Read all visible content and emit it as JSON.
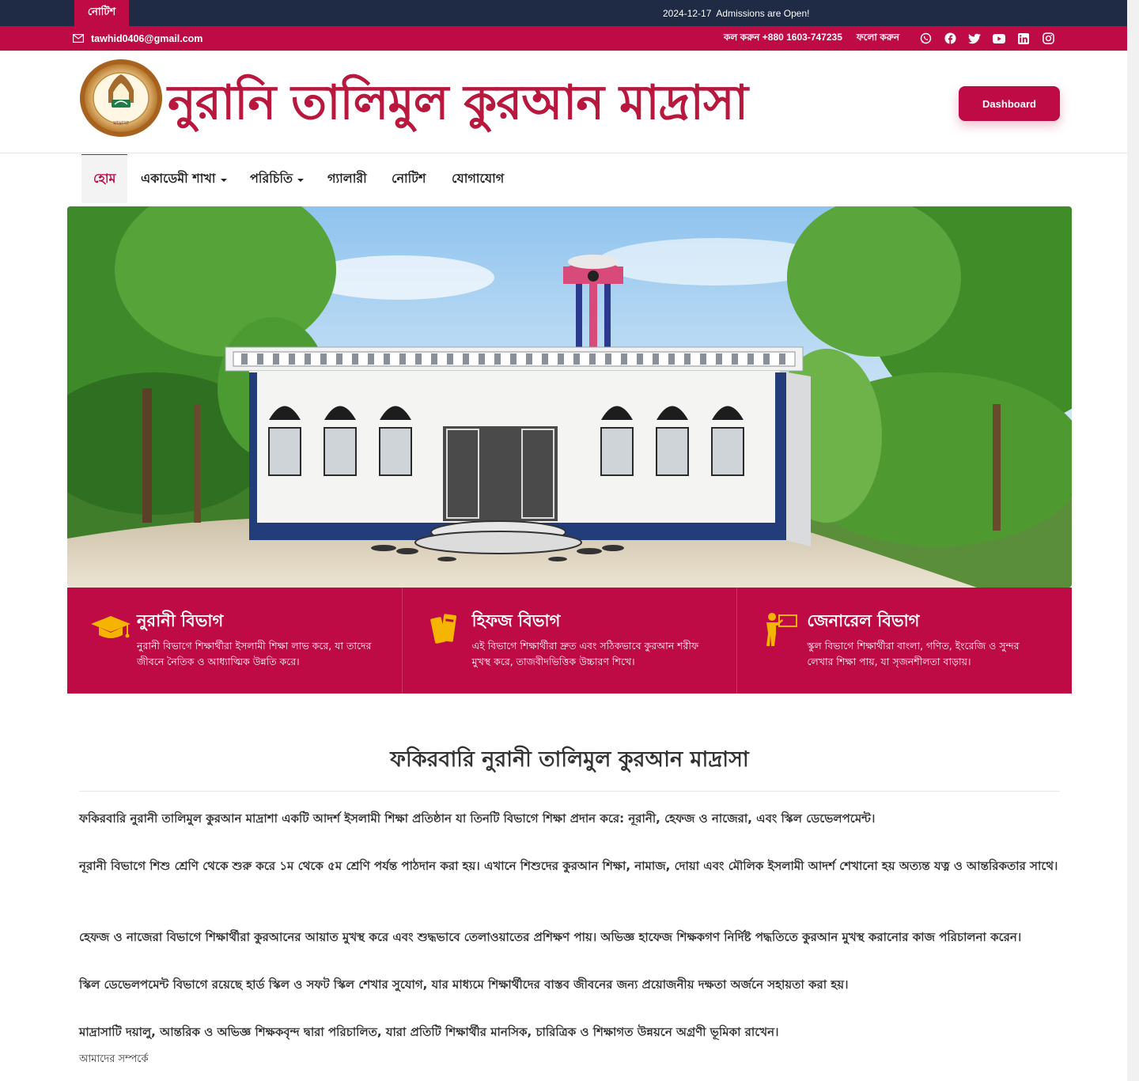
{
  "notice_bar": {
    "tag": "নোটিশ",
    "date": "2024-12-17",
    "text": "Admissions are Open!"
  },
  "contact": {
    "email": "tawhid0406@gmail.com",
    "call": "কল করুন +880 1603-747235",
    "follow": "ফলো করুন",
    "social_icons": [
      "whatsapp-icon",
      "facebook-icon",
      "twitter-icon",
      "youtube-icon",
      "linkedin-icon",
      "instagram-icon"
    ]
  },
  "header": {
    "title": "নুরানি তালিমুল কুরআন মাদ্রাসা",
    "dashboard_label": "Dashboard"
  },
  "nav": {
    "items": [
      {
        "label": "হোম",
        "active": true
      },
      {
        "label": "একাডেমী শাখা",
        "dropdown": true
      },
      {
        "label": "পরিচিতি",
        "dropdown": true
      },
      {
        "label": "গ্যালারী"
      },
      {
        "label": "নোটিশ"
      },
      {
        "label": "যোগাযোগ"
      }
    ]
  },
  "departments": [
    {
      "title": "নুরানী বিভাগ",
      "icon": "graduation-cap-icon",
      "desc": "নুরানী বিভাগে শিক্ষার্থীরা ইসলামী শিক্ষা লাভ করে, যা তাদের জীবনে নৈতিক ও আধ্যাত্মিক উন্নতি করে।"
    },
    {
      "title": "হিফজ বিভাগ",
      "icon": "books-icon",
      "desc": "এই বিভাগে শিক্ষার্থীরা দ্রুত এবং সঠিকভাবে কুরআন শরীফ মুখস্থ করে, তাজবীদভিত্তিক উচ্চারণ শিখে।"
    },
    {
      "title": "জেনারেল বিভাগ",
      "icon": "teacher-icon",
      "desc": "স্কুল বিভাগে শিক্ষার্থীরা বাংলা, গণিত, ইংরেজি ও সুন্দর লেখার শিক্ষা পায়, যা সৃজনশীলতা বাড়ায়।"
    }
  ],
  "content": {
    "title": "ফকিরবারি নুরানী তালিমুল কুরআন মাদ্রাসা",
    "paragraphs": [
      "ফকিরবারি নুরানী তালিমুল কুরআন মাদ্রাশা একটি আদর্শ ইসলামী শিক্ষা প্রতিষ্ঠান যা তিনটি বিভাগে শিক্ষা প্রদান করে: নূরানী, হেফজ ও নাজেরা, এবং স্কিল ডেভেলপমেন্ট।",
      "নূরানী বিভাগে শিশু শ্রেণি থেকে শুরু করে ১ম থেকে ৫ম শ্রেণি পর্যন্ত পাঠদান করা হয়। এখানে শিশুদের কুরআন শিক্ষা, নামাজ, দোয়া এবং মৌলিক ইসলামী আদর্শ শেখানো হয় অত্যন্ত যত্ন ও আন্তরিকতার সাথে।",
      "হেফজ ও নাজেরা বিভাগে শিক্ষার্থীরা কুরআনের আয়াত মুখস্থ করে এবং শুদ্ধভাবে তেলাওয়াতের প্রশিক্ষণ পায়। অভিজ্ঞ হাফেজ শিক্ষকগণ নির্দিষ্ট পদ্ধতিতে কুরআন মুখস্থ করানোর কাজ পরিচালনা করেন।",
      "স্কিল ডেভেলপমেন্ট বিভাগে রয়েছে হার্ড স্কিল ও সফট স্কিল শেখার সুযোগ, যার মাধ্যমে শিক্ষার্থীদের বাস্তব জীবনের জন্য প্রয়োজনীয় দক্ষতা অর্জনে সহায়তা করা হয়।",
      "মাদ্রাসাটি দয়ালু, আন্তরিক ও অভিজ্ঞ শিক্ষকবৃন্দ দ্বারা পরিচালিত, যারা প্রতিটি শিক্ষার্থীর মানসিক, চারিত্রিক ও শিক্ষাগত উন্নয়নে অগ্রণী ভূমিকা রাখেন।"
    ],
    "about_link": "আমাদের সম্পর্কে"
  },
  "colors": {
    "brand": "#be0a45",
    "dark": "#1f2a44",
    "title": "#b9183e",
    "icon_yellow": "#f4b400"
  }
}
